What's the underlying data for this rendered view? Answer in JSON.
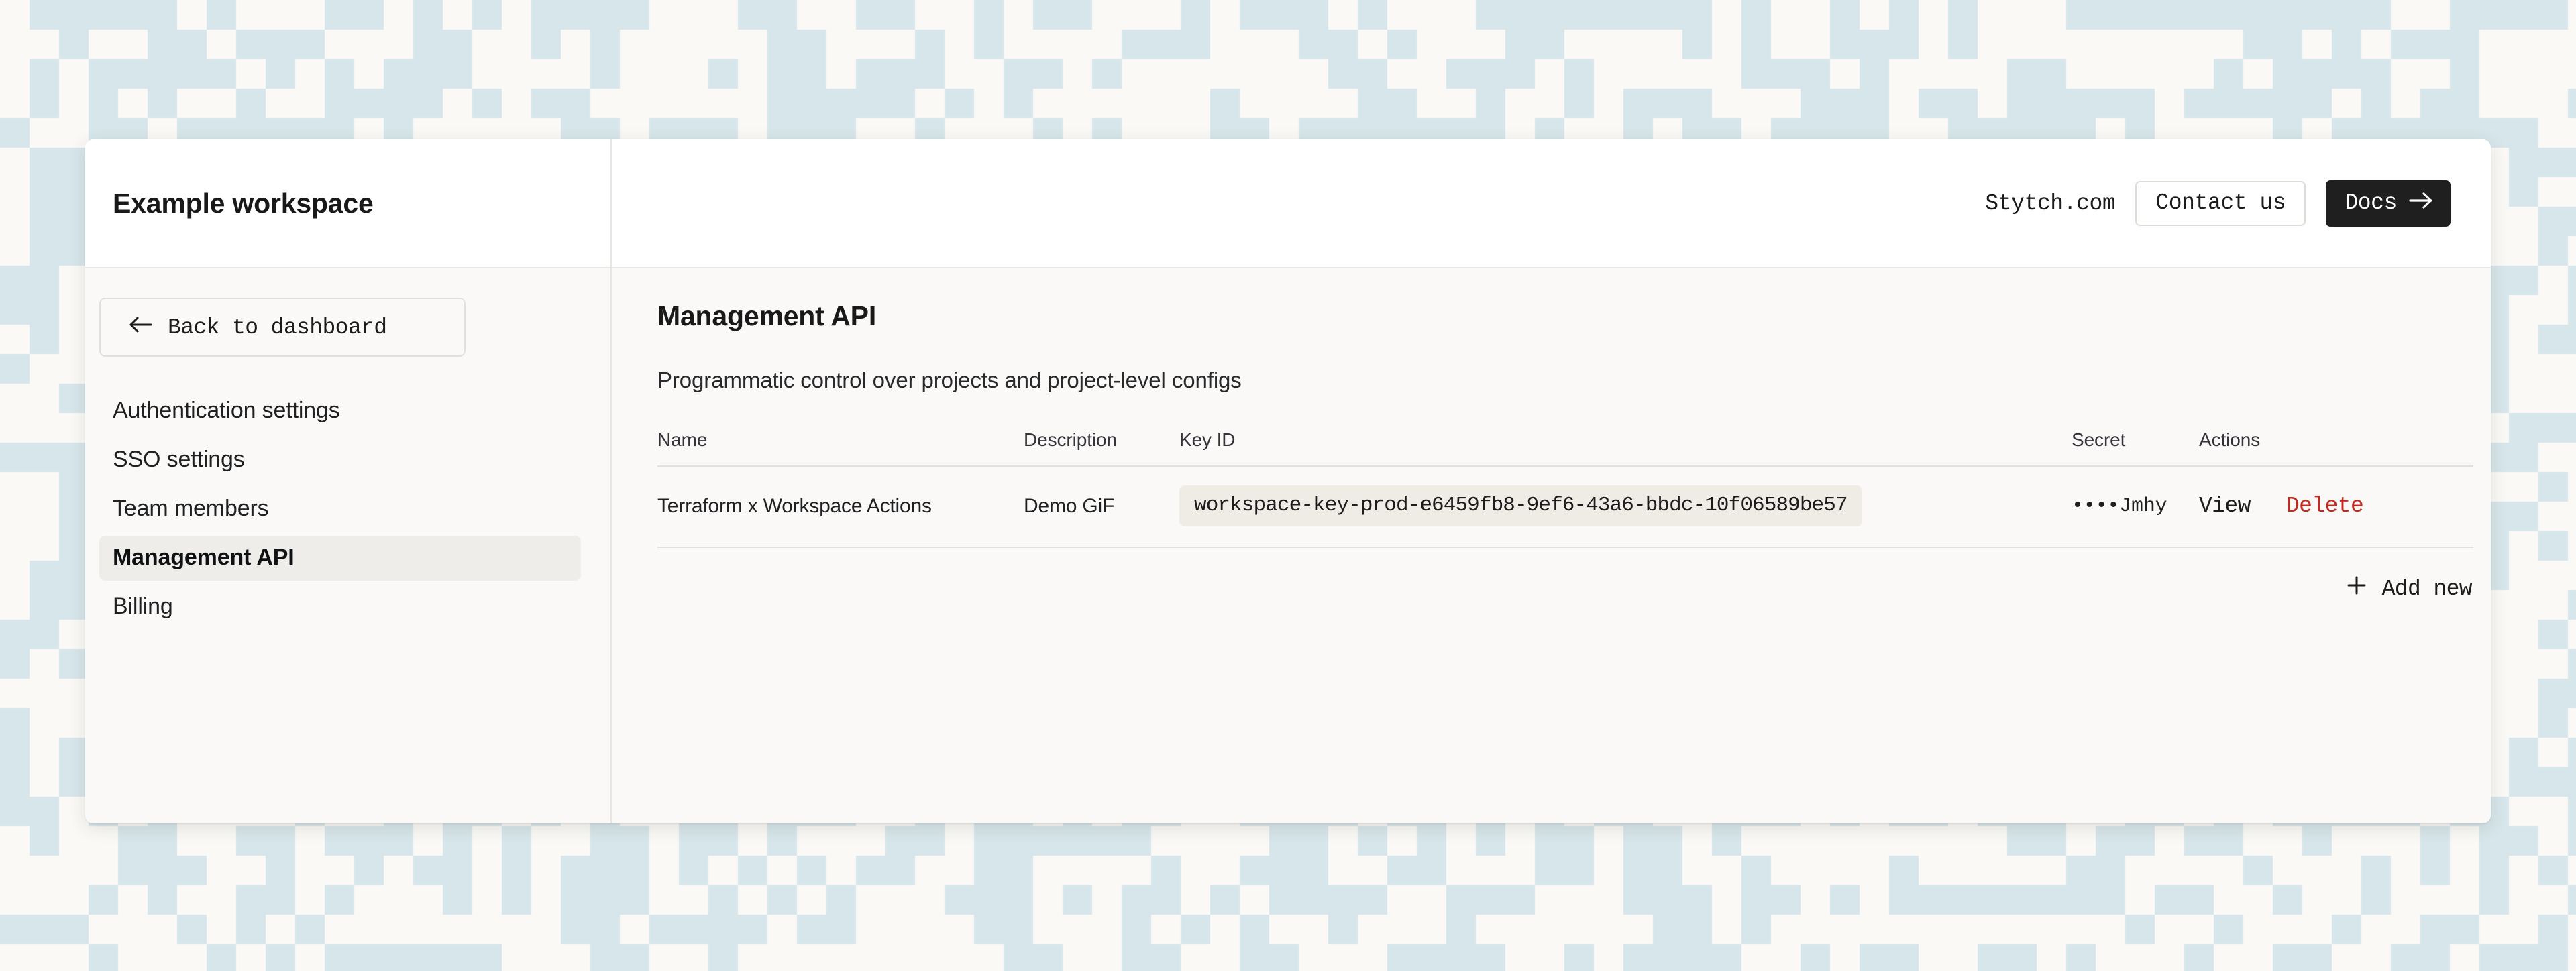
{
  "background": {
    "base_color": "#faf9f5",
    "tile_color": "#d7e6ea",
    "cell_size": 44
  },
  "header": {
    "workspace_title": "Example workspace",
    "site_link": "Stytch.com",
    "contact_button": "Contact us",
    "docs_button": "Docs",
    "docs_icon": "arrow-right-icon"
  },
  "sidebar": {
    "back_button": {
      "label": "Back to dashboard",
      "icon": "arrow-left-icon"
    },
    "items": [
      {
        "label": "Authentication settings",
        "active": false
      },
      {
        "label": "SSO settings",
        "active": false
      },
      {
        "label": "Team members",
        "active": false
      },
      {
        "label": "Management API",
        "active": true
      },
      {
        "label": "Billing",
        "active": false
      }
    ]
  },
  "main": {
    "title": "Management API",
    "subtitle": "Programmatic control over projects and project-level configs",
    "table": {
      "columns": [
        "Name",
        "Description",
        "Key ID",
        "Secret",
        "Actions"
      ],
      "rows": [
        {
          "name": "Terraform x Workspace Actions",
          "description": "Demo GiF",
          "key_id": "workspace-key-prod-e6459fb8-9ef6-43a6-bbdc-10f06589be57",
          "secret": "••••Jmhy",
          "actions": {
            "view": "View",
            "delete": "Delete"
          }
        }
      ]
    },
    "add_new": {
      "label": "Add new",
      "icon": "plus-icon"
    }
  },
  "colors": {
    "danger": "#c4291f",
    "dark_button": "#1f1f1f",
    "active_nav": "#eeedea",
    "key_pill": "#efebe5"
  }
}
